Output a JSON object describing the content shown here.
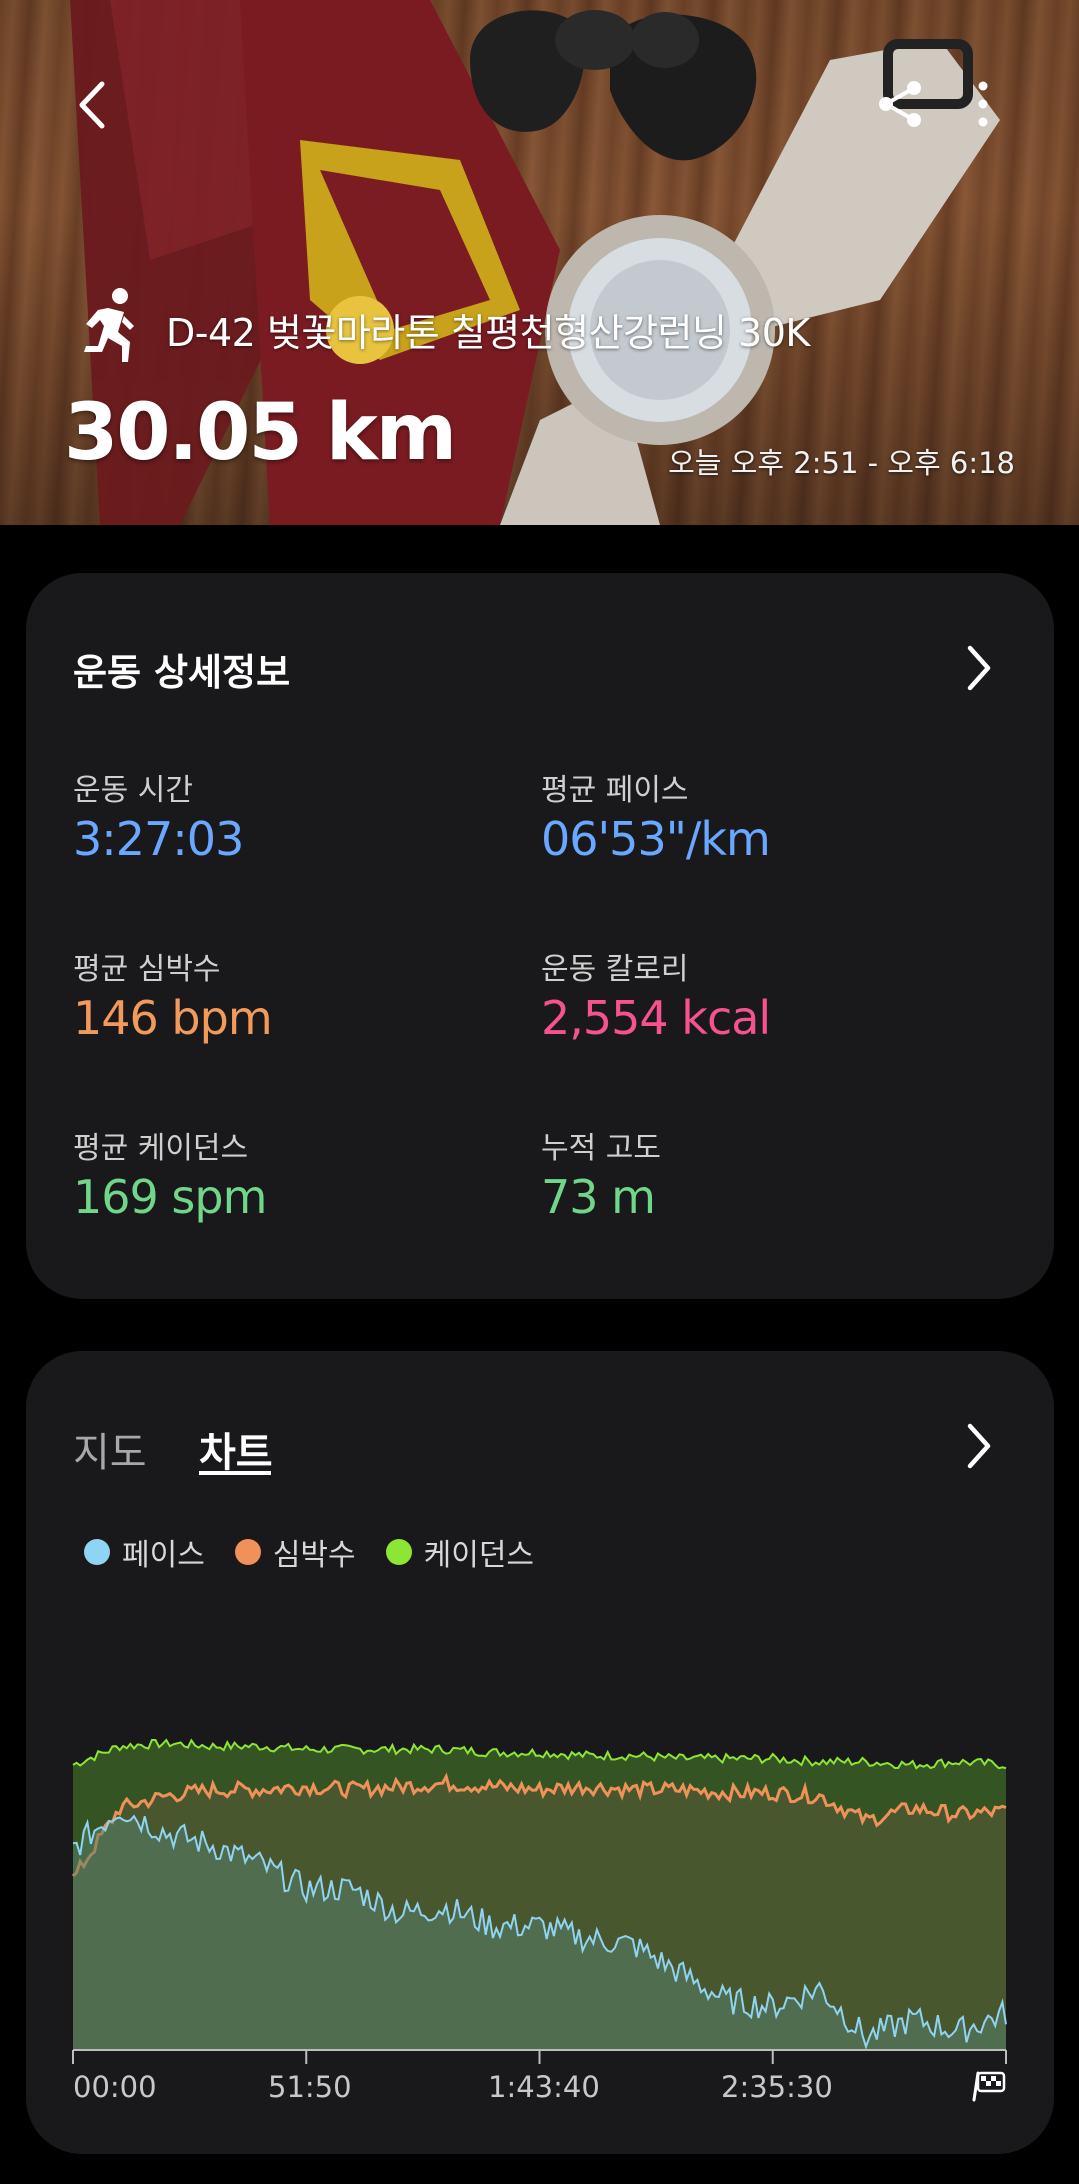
{
  "header": {
    "title": "D-42 벚꽃마라톤 칠평천형산강런닝 30K",
    "distance": "30.05 km",
    "time_range": "오늘 오후 2:51 - 오후 6:18",
    "icons": [
      "back-icon",
      "share-icon",
      "more-icon",
      "running-icon"
    ]
  },
  "details": {
    "title": "운동 상세정보",
    "stats": [
      {
        "label": "운동 시간",
        "value": "3:27:03",
        "color": "#6aa7ff"
      },
      {
        "label": "평균 페이스",
        "value": "06'53\"/km",
        "color": "#6aa7ff"
      },
      {
        "label": "평균 심박수",
        "value": "146 bpm",
        "color": "#f29a5c"
      },
      {
        "label": "운동 칼로리",
        "value": "2,554 kcal",
        "color": "#f5528f"
      },
      {
        "label": "평균 케이던스",
        "value": "169 spm",
        "color": "#6fd68a"
      },
      {
        "label": "누적 고도",
        "value": "73 m",
        "color": "#6fd68a"
      }
    ]
  },
  "chart_card": {
    "tabs": [
      "지도",
      "차트"
    ],
    "active_tab": "차트",
    "legend": [
      {
        "name": "페이스",
        "color": "#8fd4f2"
      },
      {
        "name": "심박수",
        "color": "#f0915a"
      },
      {
        "name": "케이던스",
        "color": "#8de634"
      }
    ],
    "x_ticks": [
      "00:00",
      "51:50",
      "1:43:40",
      "2:35:30"
    ]
  },
  "chart_data": {
    "type": "area",
    "x_ticks": [
      "00:00",
      "51:50",
      "1:43:40",
      "2:35:30"
    ],
    "x": [
      0,
      0.05,
      0.1,
      0.15,
      0.2,
      0.25,
      0.3,
      0.35,
      0.4,
      0.45,
      0.5,
      0.55,
      0.6,
      0.65,
      0.7,
      0.75,
      0.8,
      0.85,
      0.9,
      0.95,
      1.0
    ],
    "series": [
      {
        "name": "케이던스",
        "color": "#8de634",
        "values": [
          0.92,
          0.98,
          0.99,
          0.98,
          0.98,
          0.97,
          0.97,
          0.97,
          0.97,
          0.96,
          0.96,
          0.95,
          0.95,
          0.94,
          0.94,
          0.94,
          0.93,
          0.93,
          0.92,
          0.93,
          0.92
        ]
      },
      {
        "name": "심박수",
        "color": "#f0915a",
        "values": [
          0.55,
          0.78,
          0.82,
          0.84,
          0.84,
          0.85,
          0.84,
          0.85,
          0.86,
          0.85,
          0.84,
          0.85,
          0.84,
          0.84,
          0.83,
          0.83,
          0.82,
          0.74,
          0.78,
          0.76,
          0.77
        ]
      },
      {
        "name": "페이스",
        "color": "#8fd4f2",
        "values": [
          0.65,
          0.78,
          0.7,
          0.66,
          0.6,
          0.52,
          0.52,
          0.44,
          0.46,
          0.4,
          0.4,
          0.36,
          0.34,
          0.25,
          0.16,
          0.14,
          0.2,
          0.04,
          0.1,
          0.06,
          0.12
        ]
      }
    ]
  }
}
